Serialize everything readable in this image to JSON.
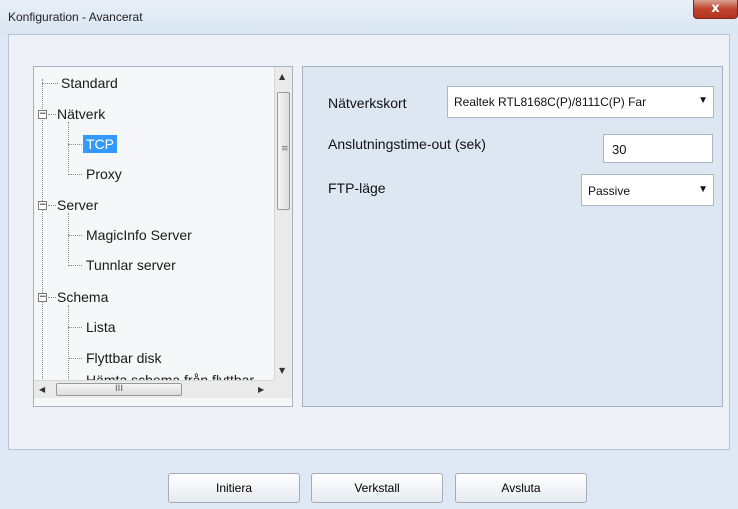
{
  "window": {
    "title": "Konfiguration - Avancerat",
    "close_label": "x"
  },
  "tree": {
    "items": [
      {
        "label": "Standard"
      },
      {
        "label": "Nätverk"
      },
      {
        "label": "TCP"
      },
      {
        "label": "Proxy"
      },
      {
        "label": "Server"
      },
      {
        "label": "MagicInfo Server"
      },
      {
        "label": "Tunnlar server"
      },
      {
        "label": "Schema"
      },
      {
        "label": "Lista"
      },
      {
        "label": "Flyttbar disk"
      },
      {
        "label": "Hämta schema från flyttbar"
      }
    ],
    "selected": "TCP",
    "hscroll_grip": "III"
  },
  "settings": {
    "nic": {
      "label": "Nätverkskort",
      "value": "Realtek RTL8168C(P)/8111C(P) Far"
    },
    "timeout": {
      "label": "Anslutningstime-out (sek)",
      "value": "30"
    },
    "ftp": {
      "label": "FTP-läge",
      "value": "Passive"
    }
  },
  "buttons": {
    "init": "Initiera",
    "apply": "Verkstall",
    "exit": "Avsluta"
  },
  "colors": {
    "selection": "#3399ff",
    "close": "#c0422e"
  }
}
